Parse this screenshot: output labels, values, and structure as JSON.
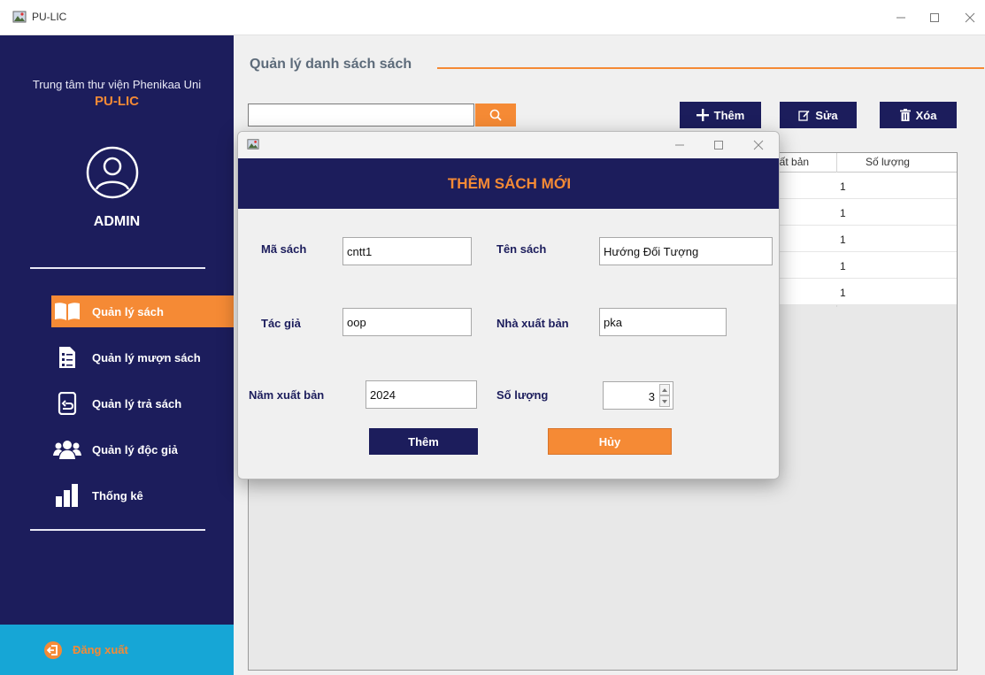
{
  "window": {
    "title": "PU-LIC"
  },
  "sidebar": {
    "center_name": "Trung tâm thư viện Phenikaa Uni",
    "brand": "PU-LIC",
    "role": "ADMIN",
    "items": [
      {
        "label": "Quản lý sách",
        "icon": "book-icon",
        "active": true
      },
      {
        "label": "Quản lý mượn sách",
        "icon": "checklist-icon",
        "active": false
      },
      {
        "label": "Quản lý trả sách",
        "icon": "return-book-icon",
        "active": false
      },
      {
        "label": "Quản lý độc giả",
        "icon": "users-icon",
        "active": false
      },
      {
        "label": "Thống kê",
        "icon": "bar-chart-icon",
        "active": false
      }
    ],
    "logout_label": "Đăng xuất"
  },
  "main": {
    "title": "Quản lý danh sách sách",
    "search": {
      "value": "",
      "placeholder": ""
    },
    "toolbar": {
      "add_label": "Thêm",
      "edit_label": "Sửa",
      "delete_label": "Xóa"
    }
  },
  "table": {
    "partial_header": "uất bản",
    "qty_header": "Số lượng",
    "rows": [
      {
        "qty": "1"
      },
      {
        "qty": "1"
      },
      {
        "qty": "1"
      },
      {
        "qty": "1"
      },
      {
        "qty": "1"
      }
    ]
  },
  "dialog": {
    "header": "THÊM SÁCH MỚI",
    "labels": {
      "book_id": "Mã sách",
      "book_name": "Tên sách",
      "author": "Tác giả",
      "publisher": "Nhà xuất bản",
      "year": "Năm xuất bản",
      "quantity": "Số lượng"
    },
    "values": {
      "book_id": "cntt1",
      "book_name": "Hướng Đối Tượng",
      "author": "oop",
      "publisher": "pka",
      "year": "2024",
      "quantity": "3"
    },
    "add_label": "Thêm",
    "cancel_label": "Hủy"
  },
  "colors": {
    "navy": "#1c1d5c",
    "orange": "#f58a35",
    "cyan": "#16a6d6"
  }
}
